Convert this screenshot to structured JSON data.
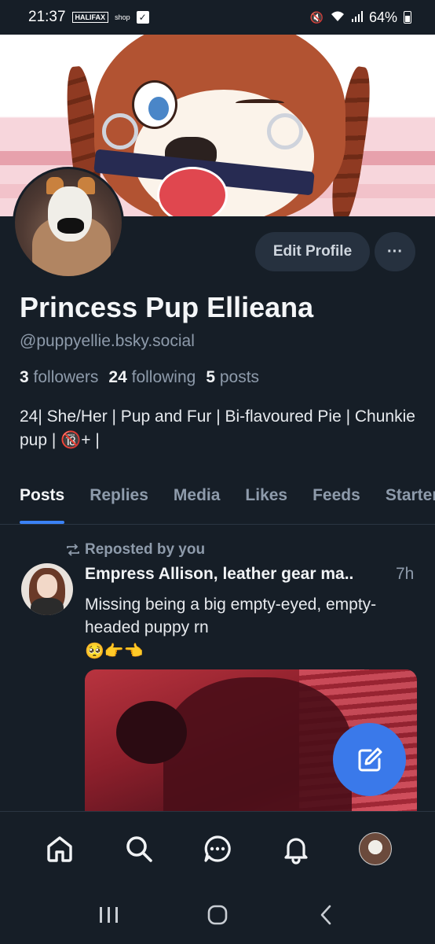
{
  "status_bar": {
    "time": "21:37",
    "carrier_logo": "HALIFAX",
    "shop_label": "shop",
    "battery": "64%"
  },
  "profile": {
    "edit_label": "Edit Profile",
    "more_label": "···",
    "display_name": "Princess Pup Ellieana",
    "handle": "@puppyellie.bsky.social",
    "stats": {
      "followers_count": "3",
      "followers_label": "followers",
      "following_count": "24",
      "following_label": "following",
      "posts_count": "5",
      "posts_label": "posts"
    },
    "bio": "24| She/Her | Pup and Fur | Bi-flavoured Pie | Chunkie pup | 🔞+ |"
  },
  "tabs": [
    "Posts",
    "Replies",
    "Media",
    "Likes",
    "Feeds",
    "Starter Packs"
  ],
  "active_tab": "Posts",
  "post": {
    "repost_label": "Reposted by you",
    "author": "Empress Allison, leather gear ma..",
    "time": "7h",
    "text": "Missing being a big empty-eyed, empty-headed puppy rn",
    "emoji": "🥺👉👈"
  },
  "bottom_nav": {
    "home_icon": "home-icon",
    "search_icon": "search-icon",
    "chat_icon": "chat-icon",
    "notifications_icon": "bell-icon",
    "profile_icon": "avatar"
  },
  "colors": {
    "background": "#161e27",
    "accent": "#3b82f6",
    "fab": "#3a79ea",
    "muted_text": "#8e9bab",
    "button_bg": "#26313f"
  }
}
